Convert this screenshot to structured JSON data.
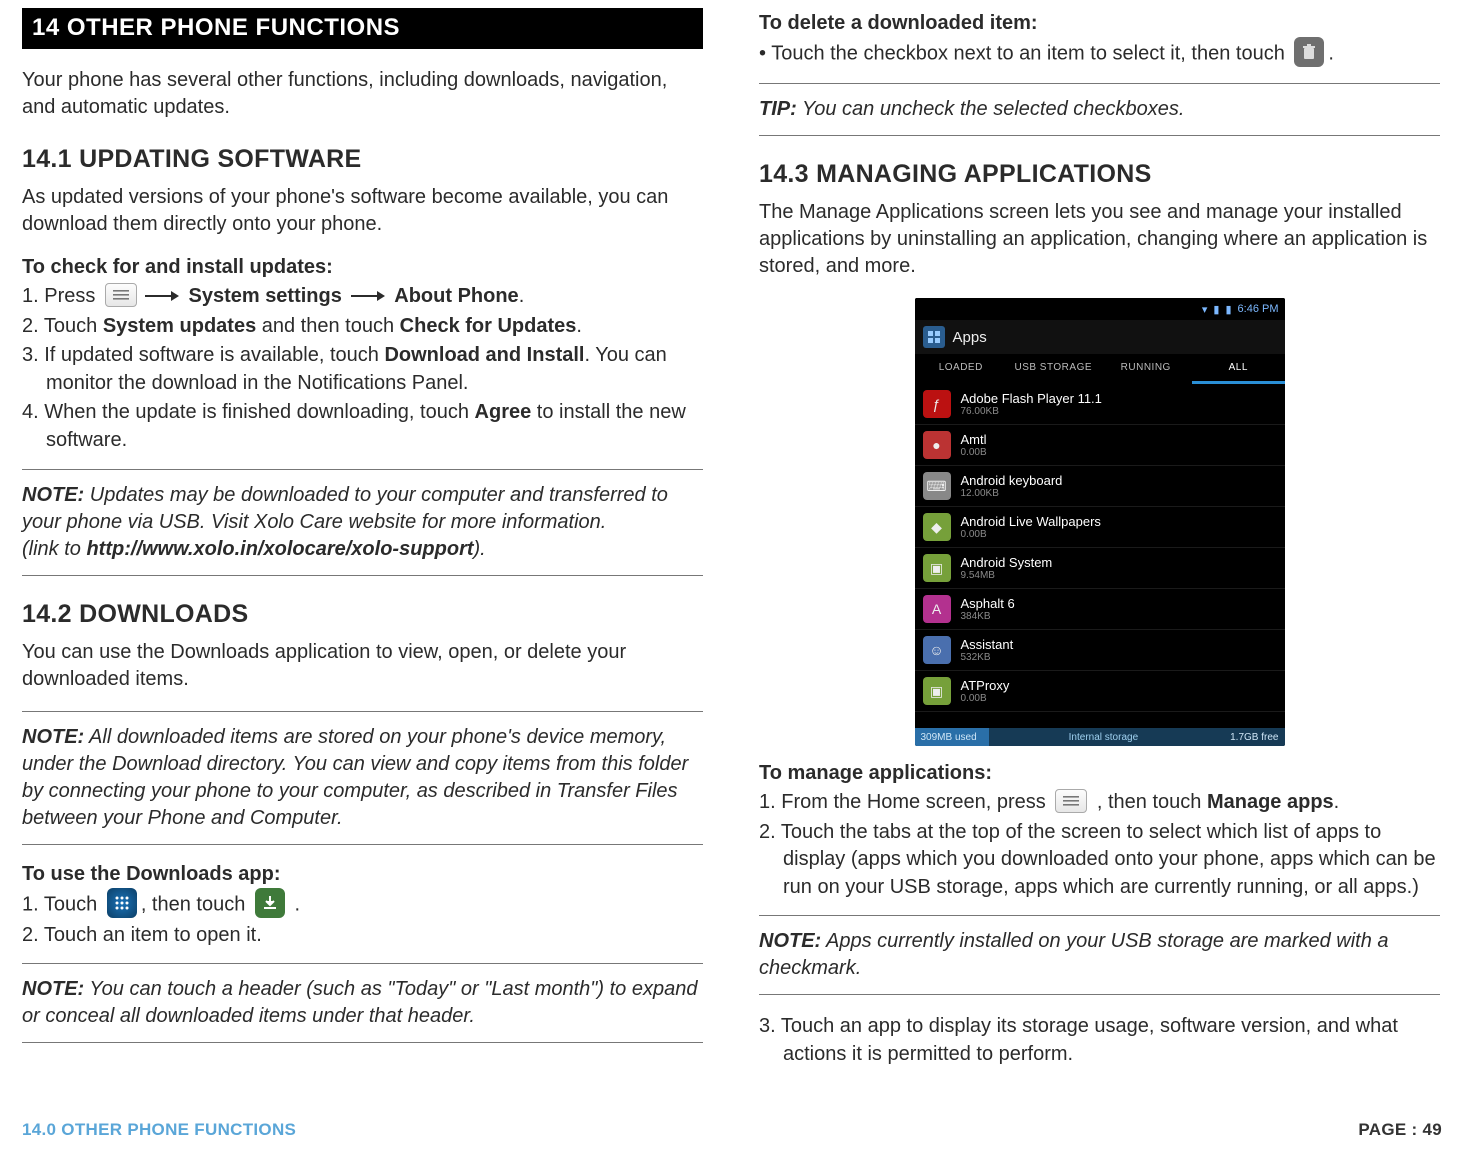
{
  "chapter_bar": "14 OTHER PHONE FUNCTIONS",
  "intro": "Your phone has several other functions, including downloads, navigation, and automatic updates.",
  "sec14_1": {
    "title": "14.1 UPDATING SOFTWARE",
    "intro": "As updated versions of your phone's software become available, you can download them directly onto your phone.",
    "checkHead": "To check for and install updates:",
    "s1a": "1. Press ",
    "s1b": " System settings ",
    "s1c": " About Phone",
    "s1d": ".",
    "s2a": "2. Touch ",
    "s2b": "System updates",
    "s2c": " and then touch ",
    "s2d": "Check for Updates",
    "s2e": ".",
    "s3a": "3. If updated software is available, touch ",
    "s3b": "Download and Install",
    "s3c": ". You can monitor the download in the Notifications Panel.",
    "s4a": "4. When the update is finished downloading, touch ",
    "s4b": "Agree",
    "s4c": " to install the new software.",
    "noteLabel": "NOTE:",
    "note1": " Updates may be downloaded to your computer and transferred to your phone via USB. Visit Xolo Care website for more information.",
    "note2a": "(link to ",
    "note2b": "http://www.xolo.in/xolocare/xolo-support",
    "note2c": ")."
  },
  "sec14_2": {
    "title": "14.2 DOWNLOADS",
    "intro": "You can use the Downloads application to view, open, or delete your downloaded items.",
    "noteLabel": "NOTE:",
    "note": " All downloaded items are stored on your phone's device memory, under the Download directory. You can view and copy items from this folder by connecting your phone to your computer, as described in Transfer Files between your Phone and Computer.",
    "useHead": "To use the Downloads app:",
    "s1a": "1. Touch ",
    "s1b": ", then touch ",
    "s1c": " .",
    "s2": "2. Touch an item to open it.",
    "note2Label": "NOTE:",
    "note2": " You can touch a header (such as \"Today\" or \"Last month\") to expand or conceal all downloaded items under that header."
  },
  "right": {
    "delHead": "To delete a downloaded item:",
    "del_a": "• Touch the checkbox next to an item to select it, then touch ",
    "del_b": ".",
    "tipLabel": "TIP:",
    "tip": " You can uncheck the selected checkboxes.",
    "sec14_3": {
      "title": "14.3 MANAGING APPLICATIONS",
      "intro": "The Manage Applications screen lets you see and manage your installed applications by uninstalling an application, changing where an application is stored, and more.",
      "mngHead": "To manage applications:",
      "s1a": "1. From the Home screen, press ",
      "s1b": " , then touch ",
      "s1c": "Manage apps",
      "s1d": ".",
      "s2": "2.  Touch the tabs at the top of the screen to select which list of apps to display (apps which you downloaded onto your phone, apps which can be run on your USB storage, apps which are currently running, or all apps.)",
      "noteLabel": "NOTE:",
      "note": " Apps currently installed on your USB storage are marked with a checkmark.",
      "s3": "3. Touch an app to display its storage usage, software version, and what actions it is permitted to perform."
    }
  },
  "phone": {
    "time": "6:46 PM",
    "title": "Apps",
    "tabs": [
      "LOADED",
      "USB STORAGE",
      "RUNNING",
      "ALL"
    ],
    "activeTab": 3,
    "rows": [
      {
        "name": "Adobe Flash Player 11.1",
        "size": "76.00KB",
        "bg": "#b11",
        "glyph": "ƒ"
      },
      {
        "name": "Amtl",
        "size": "0.00B",
        "bg": "#b33",
        "glyph": "●"
      },
      {
        "name": "Android keyboard",
        "size": "12.00KB",
        "bg": "#888",
        "glyph": "⌨"
      },
      {
        "name": "Android Live Wallpapers",
        "size": "0.00B",
        "bg": "#76a03a",
        "glyph": "◆"
      },
      {
        "name": "Android System",
        "size": "9.54MB",
        "bg": "#76a03a",
        "glyph": "▣"
      },
      {
        "name": "Asphalt 6",
        "size": "384KB",
        "bg": "#b3318f",
        "glyph": "A"
      },
      {
        "name": "Assistant",
        "size": "532KB",
        "bg": "#4a6fae",
        "glyph": "☺"
      },
      {
        "name": "ATProxy",
        "size": "0.00B",
        "bg": "#76a03a",
        "glyph": "▣"
      }
    ],
    "barLeft": "309MB used",
    "barCenter": "Internal storage",
    "barRight": "1.7GB free"
  },
  "footer": {
    "left": "14.0 OTHER PHONE FUNCTIONS",
    "right": "PAGE : 49"
  }
}
